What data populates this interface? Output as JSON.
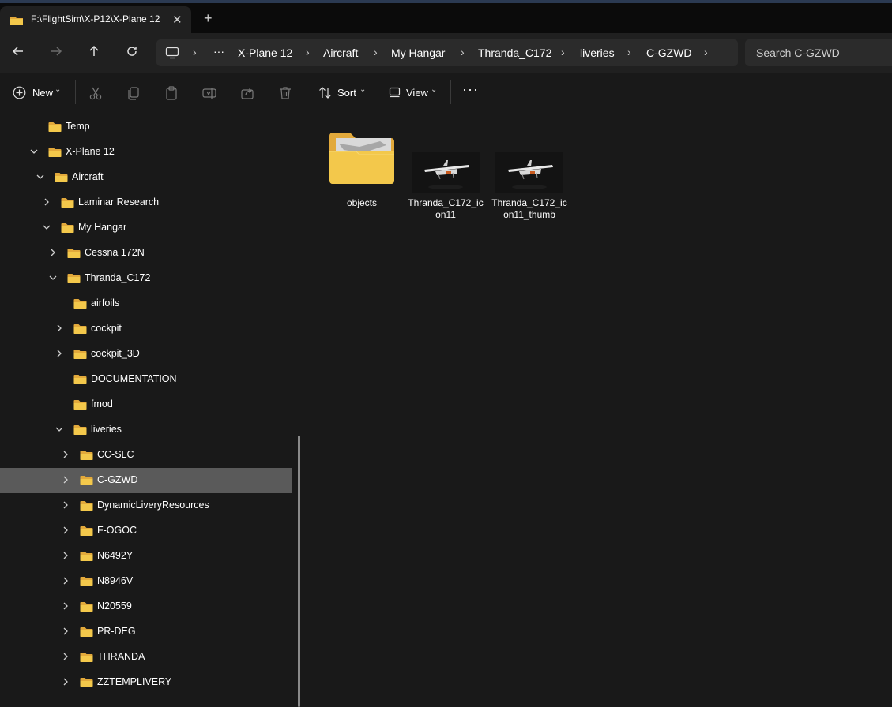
{
  "tab": {
    "title": "F:\\FlightSim\\X-P12\\X-Plane 12\\"
  },
  "nav": {
    "back_icon": "arrow-left-icon",
    "forward_icon": "arrow-right-icon",
    "up_icon": "arrow-up-icon",
    "refresh_icon": "refresh-icon"
  },
  "breadcrumb": {
    "overflow": "···",
    "items": [
      "X-Plane 12",
      "Aircraft",
      "My Hangar",
      "Thranda_C172",
      "liveries",
      "C-GZWD"
    ]
  },
  "search": {
    "placeholder": "Search C-GZWD"
  },
  "toolbar": {
    "new_label": "New",
    "sort_label": "Sort",
    "view_label": "View"
  },
  "tree": [
    {
      "label": "Temp",
      "indent": 0,
      "chevron": "none"
    },
    {
      "label": "X-Plane 12",
      "indent": 0,
      "chevron": "down"
    },
    {
      "label": "Aircraft",
      "indent": 1,
      "chevron": "down"
    },
    {
      "label": "Laminar Research",
      "indent": 2,
      "chevron": "right"
    },
    {
      "label": "My Hangar",
      "indent": 2,
      "chevron": "down"
    },
    {
      "label": "Cessna 172N",
      "indent": 3,
      "chevron": "right"
    },
    {
      "label": "Thranda_C172",
      "indent": 3,
      "chevron": "down"
    },
    {
      "label": "airfoils",
      "indent": 4,
      "chevron": "none"
    },
    {
      "label": "cockpit",
      "indent": 4,
      "chevron": "right"
    },
    {
      "label": "cockpit_3D",
      "indent": 4,
      "chevron": "right"
    },
    {
      "label": "DOCUMENTATION",
      "indent": 4,
      "chevron": "none"
    },
    {
      "label": "fmod",
      "indent": 4,
      "chevron": "none"
    },
    {
      "label": "liveries",
      "indent": 4,
      "chevron": "down"
    },
    {
      "label": "CC-SLC",
      "indent": 5,
      "chevron": "right"
    },
    {
      "label": "C-GZWD",
      "indent": 5,
      "chevron": "right",
      "selected": true
    },
    {
      "label": "DynamicLiveryResources",
      "indent": 5,
      "chevron": "right"
    },
    {
      "label": "F-OGOC",
      "indent": 5,
      "chevron": "right"
    },
    {
      "label": "N6492Y",
      "indent": 5,
      "chevron": "right"
    },
    {
      "label": "N8946V",
      "indent": 5,
      "chevron": "right"
    },
    {
      "label": "N20559",
      "indent": 5,
      "chevron": "right"
    },
    {
      "label": "PR-DEG",
      "indent": 5,
      "chevron": "right"
    },
    {
      "label": "THRANDA",
      "indent": 5,
      "chevron": "right"
    },
    {
      "label": "ZZTEMPLIVERY",
      "indent": 5,
      "chevron": "right"
    }
  ],
  "files": [
    {
      "name": "objects",
      "kind": "folder"
    },
    {
      "name": "Thranda_C172_icon11",
      "kind": "image"
    },
    {
      "name": "Thranda_C172_icon11_thumb",
      "kind": "image"
    }
  ],
  "colors": {
    "background": "#191919",
    "selected": "#5a5a5a",
    "folder": "#f3c84b",
    "folder_dark": "#e2a93b"
  }
}
